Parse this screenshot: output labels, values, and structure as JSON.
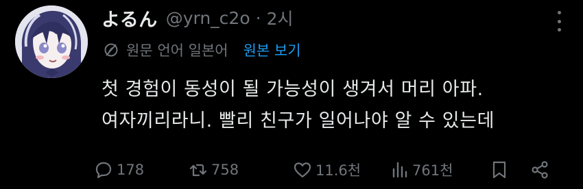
{
  "post": {
    "display_name": "よるん",
    "handle": "@yrn_c2o",
    "separator": "·",
    "time": "2시",
    "translation": {
      "note": "원문 언어 일본어",
      "show_original": "원본 보기"
    },
    "lines": [
      "첫 경험이 동성이 될 가능성이 생겨서 머리 아파.",
      "여자끼리라니. 빨리 친구가 일어나야 알 수 있는데"
    ],
    "stats": {
      "replies": "178",
      "reposts": "758",
      "likes": "11.6천",
      "views": "761천"
    }
  },
  "icons": {
    "more": "more-dots-icon",
    "translate": "translate-globe-icon",
    "reply": "reply-bubble-icon",
    "repost": "repost-arrows-icon",
    "like": "heart-icon",
    "views": "views-bar-chart-icon",
    "bookmark": "bookmark-icon",
    "share": "share-icon"
  },
  "colors": {
    "background": "#000000",
    "text_primary": "#e7e9ea",
    "text_secondary": "#71767b",
    "link": "#1d9bf0"
  }
}
